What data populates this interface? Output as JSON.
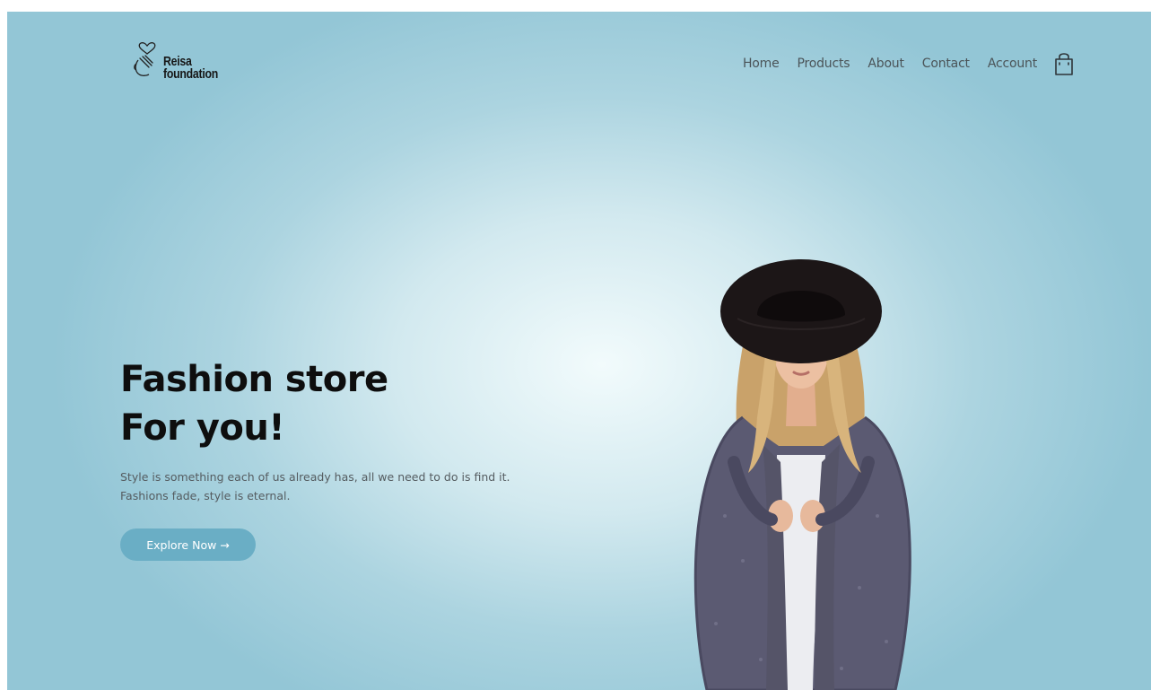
{
  "brand": {
    "line1": "Reisa",
    "line2": "foundation"
  },
  "nav": {
    "items": [
      "Home",
      "Products",
      "About",
      "Contact",
      "Account"
    ],
    "cart_icon": "shopping-bag-icon"
  },
  "hero": {
    "title_line1": "Fashion store",
    "title_line2": "For you!",
    "subtitle_line1": "Style is something each of us already has, all we need to do is find it.",
    "subtitle_line2": "Fashions fade, style is eternal.",
    "cta_label": "Explore Now →"
  },
  "colors": {
    "accent": "#6aaec5",
    "background_center": "#f2fbfc",
    "background_edge": "#93c6d6",
    "title": "#0e0e0e"
  }
}
